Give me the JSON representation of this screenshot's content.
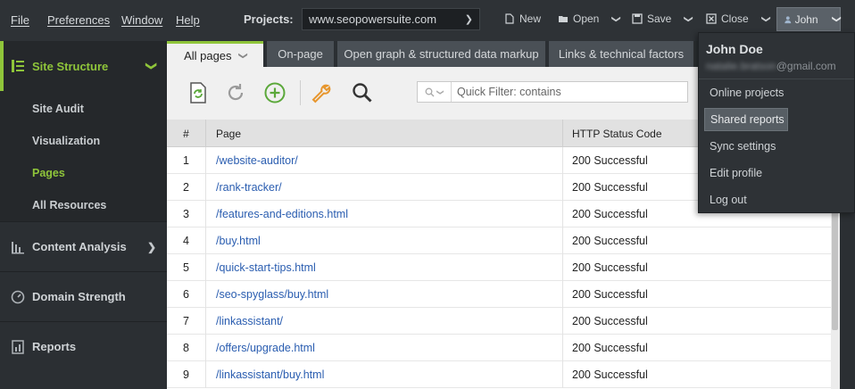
{
  "menu": {
    "file": "File",
    "preferences": "Preferences",
    "window": "Window",
    "help": "Help"
  },
  "toolbar_top": {
    "projects_label": "Projects:",
    "project_value": "www.seopowersuite.com",
    "new_label": "New",
    "open_label": "Open",
    "save_label": "Save",
    "close_label": "Close",
    "user_label": "John"
  },
  "sidebar": {
    "site_structure": "Site Structure",
    "sub_items": [
      "Site Audit",
      "Visualization",
      "Pages",
      "All Resources"
    ],
    "content_analysis": "Content Analysis",
    "domain_strength": "Domain Strength",
    "reports": "Reports"
  },
  "tabs": [
    "All pages",
    "On-page",
    "Open graph & structured data markup",
    "Links & technical factors"
  ],
  "filter": {
    "placeholder": "Quick Filter: contains"
  },
  "table": {
    "headers": [
      "#",
      "Page",
      "HTTP Status Code"
    ],
    "rows": [
      {
        "num": "1",
        "page": "/website-auditor/",
        "status": "200 Successful"
      },
      {
        "num": "2",
        "page": "/rank-tracker/",
        "status": "200 Successful"
      },
      {
        "num": "3",
        "page": "/features-and-editions.html",
        "status": "200 Successful"
      },
      {
        "num": "4",
        "page": "/buy.html",
        "status": "200 Successful"
      },
      {
        "num": "5",
        "page": "/quick-start-tips.html",
        "status": "200 Successful"
      },
      {
        "num": "6",
        "page": "/seo-spyglass/buy.html",
        "status": "200 Successful"
      },
      {
        "num": "7",
        "page": "/linkassistant/",
        "status": "200 Successful"
      },
      {
        "num": "8",
        "page": "/offers/upgrade.html",
        "status": "200 Successful"
      },
      {
        "num": "9",
        "page": "/linkassistant/buy.html",
        "status": "200 Successful"
      }
    ]
  },
  "user_menu": {
    "name": "John Doe",
    "email_blurred": "natalie.bratson",
    "email_domain": "@gmail.com",
    "items": [
      "Online projects",
      "Shared reports",
      "Sync settings",
      "Edit profile",
      "Log out"
    ]
  },
  "colors": {
    "accent": "#8fc53a",
    "link": "#2a5db0",
    "dark_bg": "#2b2f33"
  }
}
